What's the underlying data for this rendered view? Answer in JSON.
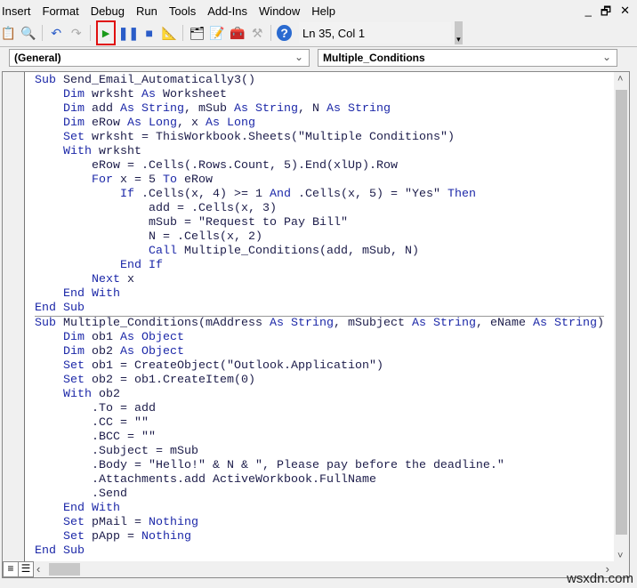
{
  "menu": [
    "Insert",
    "Format",
    "Debug",
    "Run",
    "Tools",
    "Add-Ins",
    "Window",
    "Help"
  ],
  "window_controls": {
    "minimize": "_",
    "restore": "🗗",
    "close": "✕"
  },
  "toolbar": {
    "position": "Ln 35, Col 1",
    "highlighted_button": "run",
    "highlight_color": "#e01010"
  },
  "combos": {
    "object": "(General)",
    "procedure": "Multiple_Conditions"
  },
  "keywords": [
    "Sub",
    "Dim",
    "As",
    "String",
    "Long",
    "Set",
    "With",
    "For",
    "To",
    "If",
    "And",
    "Then",
    "Call",
    "End",
    "Next",
    "Object",
    "Nothing"
  ],
  "code": [
    "Sub Send_Email_Automatically3()",
    "    Dim wrksht As Worksheet",
    "    Dim add As String, mSub As String, N As String",
    "    Dim eRow As Long, x As Long",
    "    Set wrksht = ThisWorkbook.Sheets(\"Multiple Conditions\")",
    "    With wrksht",
    "        eRow = .Cells(.Rows.Count, 5).End(xlUp).Row",
    "        For x = 5 To eRow",
    "            If .Cells(x, 4) >= 1 And .Cells(x, 5) = \"Yes\" Then",
    "                add = .Cells(x, 3)",
    "                mSub = \"Request to Pay Bill\"",
    "                N = .Cells(x, 2)",
    "                Call Multiple_Conditions(add, mSub, N)",
    "            End If",
    "        Next x",
    "    End With",
    "End Sub",
    "Sub Multiple_Conditions(mAddress As String, mSubject As String, eName As String)",
    "    Dim ob1 As Object",
    "    Dim ob2 As Object",
    "    Set ob1 = CreateObject(\"Outlook.Application\")",
    "    Set ob2 = ob1.CreateItem(0)",
    "    With ob2",
    "        .To = add",
    "        .CC = \"\"",
    "        .BCC = \"\"",
    "        .Subject = mSub",
    "        .Body = \"Hello!\" & N & \", Please pay before the deadline.\"",
    "        .Attachments.add ActiveWorkbook.FullName",
    "        .Send",
    "    End With",
    "    Set pMail = Nothing",
    "    Set pApp = Nothing",
    "End Sub"
  ],
  "watermark": "wsxdn.com"
}
